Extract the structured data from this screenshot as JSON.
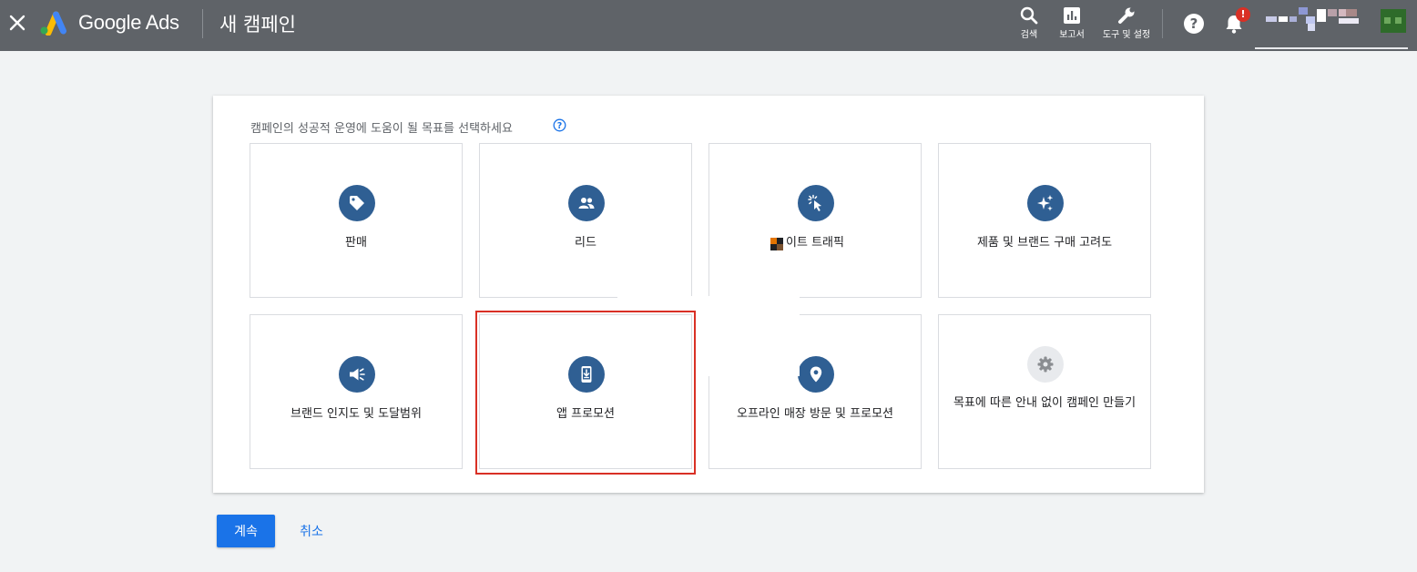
{
  "app": {
    "brand": "Google Ads",
    "page_title": "새 캠페인"
  },
  "toolbar": {
    "search_label": "검색",
    "reports_label": "보고서",
    "tools_label": "도구 및 설정",
    "notification_badge": "!"
  },
  "goal_picker": {
    "prompt": "캠페인의 성공적 운영에 도움이 될 목표를 선택하세요",
    "selected": "앱 프로모션",
    "tiles": [
      {
        "label": "판매",
        "icon": "tag-icon"
      },
      {
        "label": "리드",
        "icon": "people-icon"
      },
      {
        "label": "이트 트래픽",
        "icon": "cursor-click-icon"
      },
      {
        "label": "제품 및 브랜드 구매 고려도",
        "icon": "sparkle-icon"
      },
      {
        "label": "브랜드 인지도 및 도달범위",
        "icon": "megaphone-icon"
      },
      {
        "label": "앱 프로모션",
        "icon": "phone-download-icon"
      },
      {
        "label": "오프라인 매장 방문 및 프로모션",
        "icon": "location-pin-icon"
      },
      {
        "label": "목표에 따른 안내 없이 캠페인 만들기",
        "icon": "gear-icon"
      }
    ]
  },
  "actions": {
    "continue_label": "계속",
    "cancel_label": "취소"
  },
  "colors": {
    "topbar": "#5f6368",
    "icon_circle": "#2f5f93",
    "primary": "#1a73e8",
    "selected_border": "#d93025",
    "alert_red": "#d93025"
  }
}
